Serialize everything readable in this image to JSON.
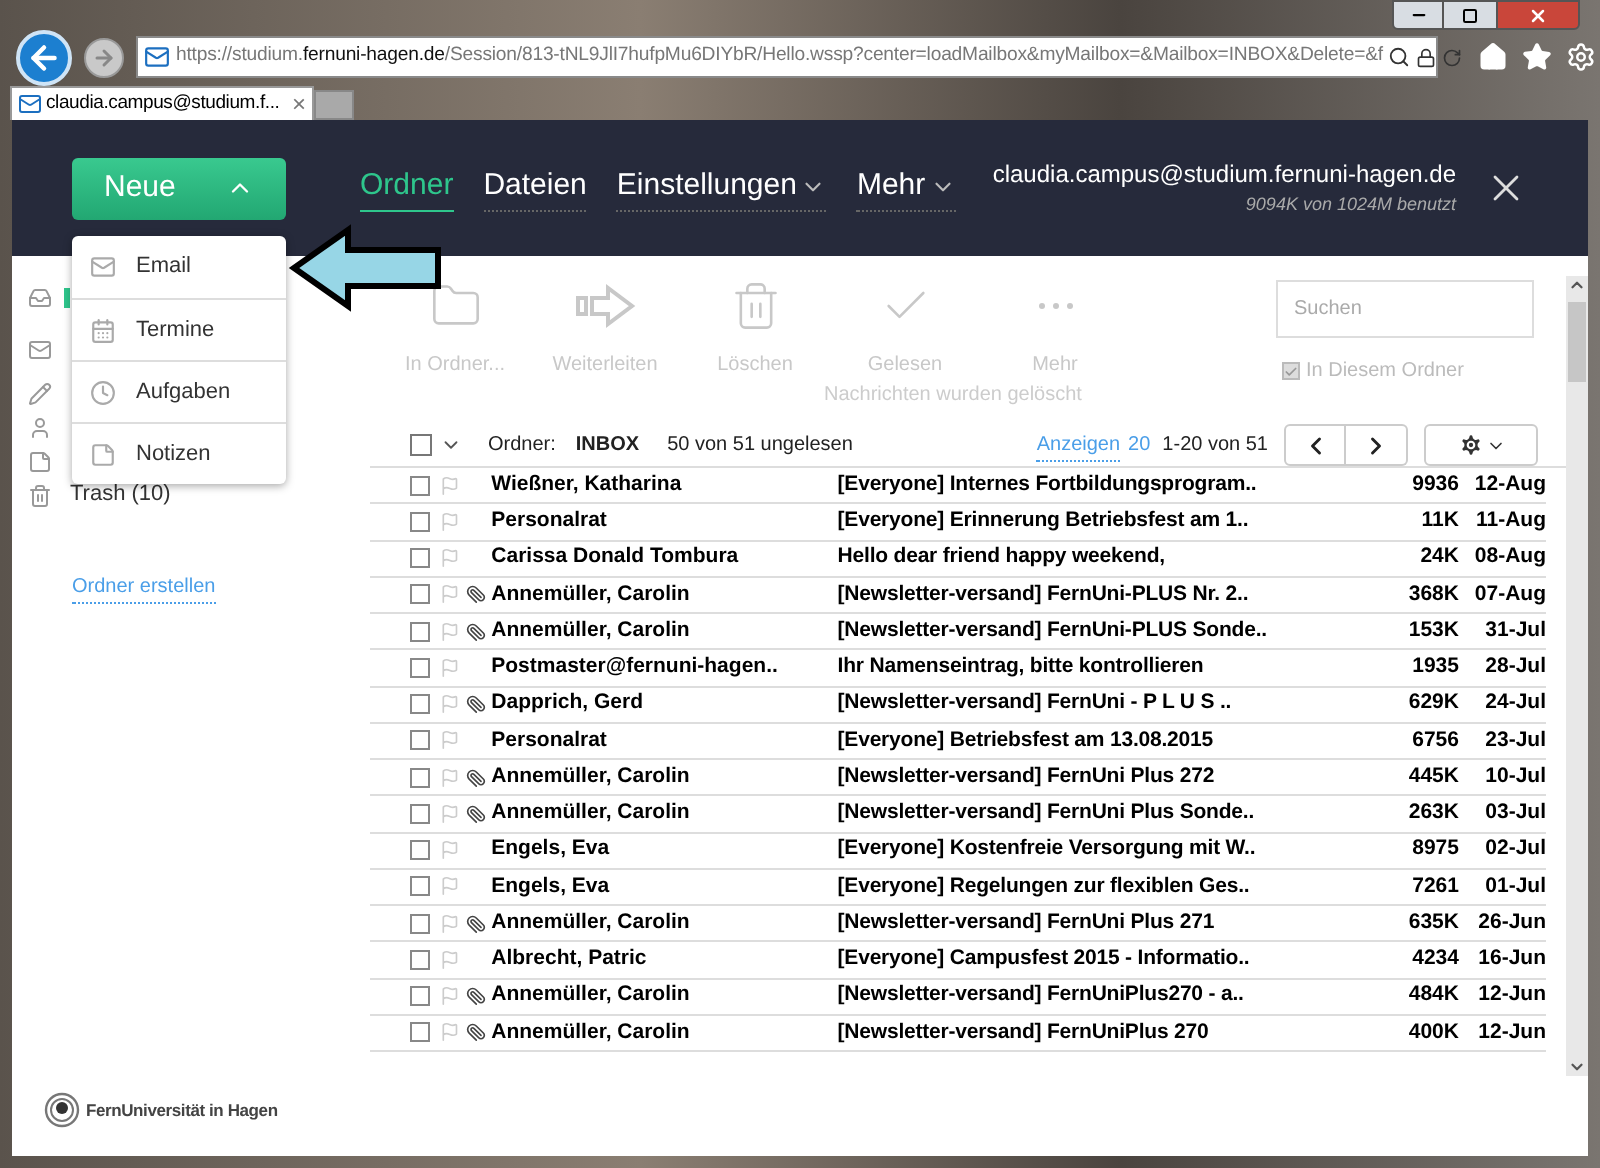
{
  "browser": {
    "url": "https://studium.**fernuni-hagen.de**/Session/813-tNL9JlI7hufpMu6DIYbR/Hello.wssp?center=loadMailbox&myMailbox=&Mailbox=INBOX&Delete=&f",
    "tab": {
      "title": "claudia.campus@studium.f...",
      "close": "×"
    }
  },
  "header": {
    "new_button": "Neue",
    "nav": [
      {
        "label": "Ordner",
        "selected": true,
        "dropdown": false
      },
      {
        "label": "Dateien",
        "selected": false,
        "dropdown": false
      },
      {
        "label": "Einstellungen",
        "selected": false,
        "dropdown": true
      },
      {
        "label": "Mehr",
        "selected": false,
        "dropdown": true
      }
    ],
    "user": "claudia.campus@studium.fernuni-hagen.de",
    "quota": "9094K von 1024M benutzt"
  },
  "new_menu": [
    {
      "label": "Email",
      "kind": "mail"
    },
    {
      "label": "Termine",
      "kind": "calendar"
    },
    {
      "label": "Aufgaben",
      "kind": "task"
    },
    {
      "label": "Notizen",
      "kind": "note"
    }
  ],
  "sidebar": {
    "items": [
      {
        "kind": "inbox",
        "selected": true
      },
      {
        "kind": "mail",
        "selected": false
      },
      {
        "kind": "draft",
        "selected": false
      },
      {
        "kind": "contacts",
        "selected": false
      },
      {
        "kind": "notes",
        "selected": false
      },
      {
        "label": "Trash (10)",
        "kind": "trash",
        "selected": false
      }
    ],
    "create_folder": "Ordner erstellen"
  },
  "toolbar": [
    {
      "label": "In Ordner...",
      "kind": "folder",
      "disabled": true
    },
    {
      "label": "Weiterleiten",
      "kind": "forward",
      "disabled": true
    },
    {
      "label": "Löschen",
      "kind": "delete",
      "disabled": true
    },
    {
      "label": "Gelesen",
      "kind": "read",
      "disabled": true
    },
    {
      "label": "Mehr",
      "kind": "more",
      "disabled": true
    }
  ],
  "status_message": "Nachrichten wurden gelöscht",
  "search": {
    "placeholder": "Suchen",
    "scope_label": "In Diesem Ordner",
    "scope_checked": true
  },
  "list_header": {
    "select_all_checked": false,
    "folder_label": "Ordner:",
    "folder": "INBOX",
    "unread": "50 von 51 ungelesen",
    "show_label": "Anzeigen",
    "show_count": "20",
    "range": "1-20 von 51"
  },
  "messages": [
    {
      "sender": "Wießner, Katharina",
      "subject": "[Everyone] Internes Fortbildungsprogram..",
      "size": "9936",
      "date": "12-Aug",
      "attachment": false,
      "unread": true,
      "checked": false
    },
    {
      "sender": "Personalrat",
      "subject": "[Everyone] Erinnerung Betriebsfest am 1..",
      "size": "11K",
      "date": "11-Aug",
      "attachment": false,
      "unread": true,
      "checked": false
    },
    {
      "sender": "Carissa Donald Tombura",
      "subject": "Hello dear friend happy weekend,",
      "size": "24K",
      "date": "08-Aug",
      "attachment": false,
      "unread": true,
      "checked": false
    },
    {
      "sender": "Annemüller, Carolin",
      "subject": "[Newsletter-versand] FernUni-PLUS Nr. 2..",
      "size": "368K",
      "date": "07-Aug",
      "attachment": true,
      "unread": true,
      "checked": false
    },
    {
      "sender": "Annemüller, Carolin",
      "subject": "[Newsletter-versand] FernUni-PLUS Sonde..",
      "size": "153K",
      "date": "31-Jul",
      "attachment": true,
      "unread": true,
      "checked": false
    },
    {
      "sender": "Postmaster@fernuni-hagen..",
      "subject": "Ihr Namenseintrag, bitte kontrollieren",
      "size": "1935",
      "date": "28-Jul",
      "attachment": false,
      "unread": true,
      "checked": false
    },
    {
      "sender": "Dapprich, Gerd",
      "subject": "[Newsletter-versand] FernUni - P L U S ..",
      "size": "629K",
      "date": "24-Jul",
      "attachment": true,
      "unread": true,
      "checked": false
    },
    {
      "sender": "Personalrat",
      "subject": "[Everyone] Betriebsfest am 13.08.2015",
      "size": "6756",
      "date": "23-Jul",
      "attachment": false,
      "unread": true,
      "checked": false
    },
    {
      "sender": "Annemüller, Carolin",
      "subject": "[Newsletter-versand] FernUni Plus 272",
      "size": "445K",
      "date": "10-Jul",
      "attachment": true,
      "unread": true,
      "checked": false
    },
    {
      "sender": "Annemüller, Carolin",
      "subject": "[Newsletter-versand] FernUni Plus Sonde..",
      "size": "263K",
      "date": "03-Jul",
      "attachment": true,
      "unread": true,
      "checked": false
    },
    {
      "sender": "Engels, Eva",
      "subject": "[Everyone] Kostenfreie Versorgung mit W..",
      "size": "8975",
      "date": "02-Jul",
      "attachment": false,
      "unread": true,
      "checked": false
    },
    {
      "sender": "Engels, Eva",
      "subject": "[Everyone] Regelungen zur flexiblen Ges..",
      "size": "7261",
      "date": "01-Jul",
      "attachment": false,
      "unread": true,
      "checked": false
    },
    {
      "sender": "Annemüller, Carolin",
      "subject": "[Newsletter-versand] FernUni Plus 271",
      "size": "635K",
      "date": "26-Jun",
      "attachment": true,
      "unread": true,
      "checked": false
    },
    {
      "sender": "Albrecht, Patric",
      "subject": "[Everyone] Campusfest 2015 - Informatio..",
      "size": "4234",
      "date": "16-Jun",
      "attachment": false,
      "unread": true,
      "checked": false
    },
    {
      "sender": "Annemüller, Carolin",
      "subject": "[Newsletter-versand] FernUniPlus270 - a..",
      "size": "484K",
      "date": "12-Jun",
      "attachment": true,
      "unread": true,
      "checked": false
    },
    {
      "sender": "Annemüller, Carolin",
      "subject": "[Newsletter-versand] FernUniPlus 270",
      "size": "400K",
      "date": "12-Jun",
      "attachment": true,
      "unread": true,
      "checked": false
    }
  ],
  "footer": {
    "logo_text": "FernUniversität in Hagen"
  }
}
